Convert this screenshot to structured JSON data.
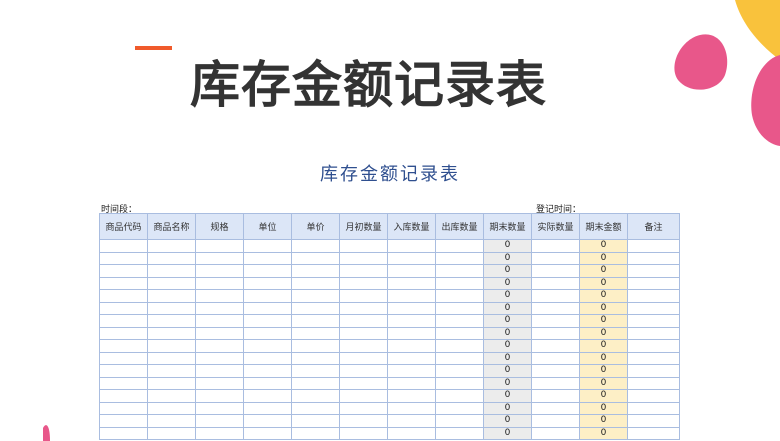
{
  "slide": {
    "title": "库存金额记录表"
  },
  "sheet": {
    "title": "库存金额记录表",
    "period_label": "时间段：",
    "record_time_label": "登记时间：",
    "columns": [
      "商品代码",
      "商品名称",
      "规格",
      "单位",
      "单价",
      "月初数量",
      "入库数量",
      "出库数量",
      "期末数量",
      "实际数量",
      "期末金额",
      "备注"
    ],
    "rows": [
      {
        "closing_qty": "0",
        "closing_amount": "0"
      },
      {
        "closing_qty": "0",
        "closing_amount": "0"
      },
      {
        "closing_qty": "0",
        "closing_amount": "0"
      },
      {
        "closing_qty": "0",
        "closing_amount": "0"
      },
      {
        "closing_qty": "0",
        "closing_amount": "0"
      },
      {
        "closing_qty": "0",
        "closing_amount": "0"
      },
      {
        "closing_qty": "0",
        "closing_amount": "0"
      },
      {
        "closing_qty": "0",
        "closing_amount": "0"
      },
      {
        "closing_qty": "0",
        "closing_amount": "0"
      },
      {
        "closing_qty": "0",
        "closing_amount": "0"
      },
      {
        "closing_qty": "0",
        "closing_amount": "0"
      },
      {
        "closing_qty": "0",
        "closing_amount": "0"
      },
      {
        "closing_qty": "0",
        "closing_amount": "0"
      },
      {
        "closing_qty": "0",
        "closing_amount": "0"
      },
      {
        "closing_qty": "0",
        "closing_amount": "0"
      },
      {
        "closing_qty": "0",
        "closing_amount": "0"
      }
    ]
  },
  "colors": {
    "accent": "#f05a2b",
    "blob_yellow": "#f9c23c",
    "blob_pink": "#e8578a",
    "header_fill": "#dce6f7",
    "grid_line": "#a9bde0",
    "closing_qty_fill": "#ececec",
    "closing_amount_fill": "#fdefc6"
  }
}
